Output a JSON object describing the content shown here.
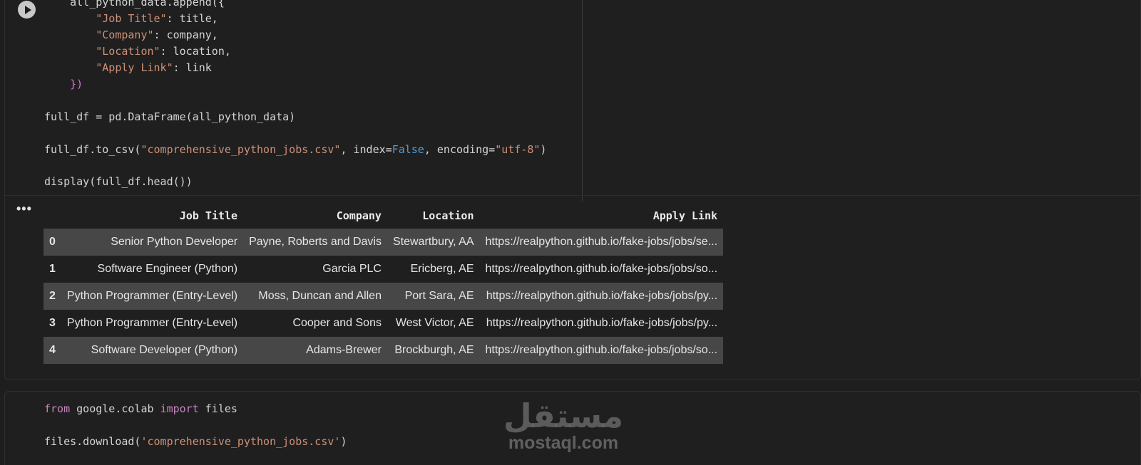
{
  "cell1": {
    "code": {
      "line1": "    all_python_data.append({",
      "line2_key": "\"Job Title\"",
      "line2_rest": ": title,",
      "line3_key": "\"Company\"",
      "line3_rest": ": company,",
      "line4_key": "\"Location\"",
      "line4_rest": ": location,",
      "line5_key": "\"Apply Link\"",
      "line5_rest": ": link",
      "line6": "    })",
      "line7": "full_df = pd.DataFrame(all_python_data)",
      "line8_a": "full_df.to_csv(",
      "line8_str": "\"comprehensive_python_jobs.csv\"",
      "line8_b": ", index=",
      "line8_bool": "False",
      "line8_c": ", encoding=",
      "line8_enc": "\"utf-8\"",
      "line8_d": ")",
      "line9": "display(full_df.head())"
    },
    "output": {
      "menu_label": "•••",
      "columns": [
        "Job Title",
        "Company",
        "Location",
        "Apply Link"
      ],
      "rows": [
        {
          "idx": "0",
          "title": "Senior Python Developer",
          "company": "Payne, Roberts and Davis",
          "location": "Stewartbury, AA",
          "link": "https://realpython.github.io/fake-jobs/jobs/se..."
        },
        {
          "idx": "1",
          "title": "Software Engineer (Python)",
          "company": "Garcia PLC",
          "location": "Ericberg, AE",
          "link": "https://realpython.github.io/fake-jobs/jobs/so..."
        },
        {
          "idx": "2",
          "title": "Python Programmer (Entry-Level)",
          "company": "Moss, Duncan and Allen",
          "location": "Port Sara, AE",
          "link": "https://realpython.github.io/fake-jobs/jobs/py..."
        },
        {
          "idx": "3",
          "title": "Python Programmer (Entry-Level)",
          "company": "Cooper and Sons",
          "location": "West Victor, AE",
          "link": "https://realpython.github.io/fake-jobs/jobs/py..."
        },
        {
          "idx": "4",
          "title": "Software Developer (Python)",
          "company": "Adams-Brewer",
          "location": "Brockburgh, AE",
          "link": "https://realpython.github.io/fake-jobs/jobs/so..."
        }
      ]
    }
  },
  "cell2": {
    "code": {
      "from_kw": "from",
      "module": " google.colab ",
      "import_kw": "import",
      "name": " files",
      "dl_a": "files.download(",
      "dl_str": "'comprehensive_python_jobs.csv'",
      "dl_b": ")"
    }
  },
  "watermark": {
    "arabic": "مستقل",
    "latin": "mostaql.com"
  },
  "colors": {
    "string": "#ce9178",
    "keyword": "#c586c0",
    "boolean": "#569cd6",
    "bracket_outer": "#ffd700",
    "bracket_inner": "#da70d6"
  },
  "icons": {
    "run": "play-circle-icon",
    "output_menu": "more-horiz-icon"
  }
}
